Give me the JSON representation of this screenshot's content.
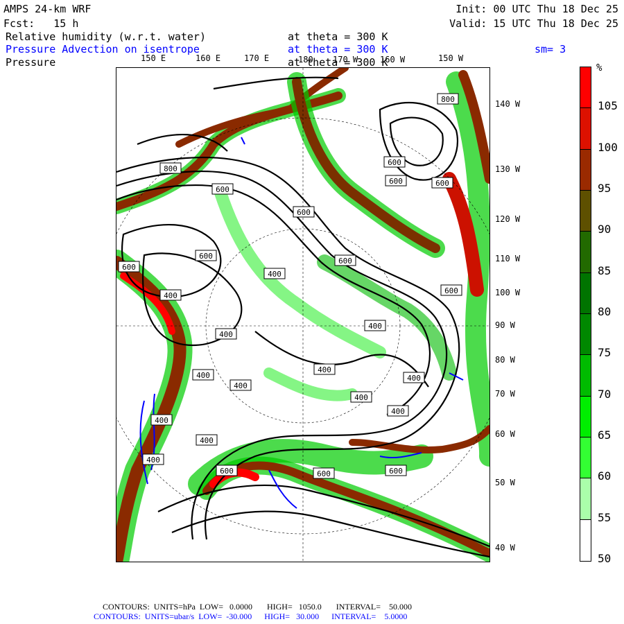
{
  "header": {
    "model": "AMPS 24-km WRF",
    "fcst": "Fcst:   15 h",
    "init": "Init: 00 UTC Thu 18 Dec 25",
    "valid": "Valid: 15 UTC Thu 18 Dec 25",
    "field1": "Relative humidity (w.r.t. water)",
    "field1_level": "at theta = 300 K",
    "field2": "Pressure Advection on isentrope",
    "field2_level": "at theta = 300 K",
    "smoothing": "sm= 3",
    "field3": "Pressure",
    "field3_level": "at theta = 300 K"
  },
  "top_longitudes": [
    "150 E",
    "160 E",
    "170 E",
    "180",
    "170 W",
    "160 W",
    "150 W"
  ],
  "right_longitudes": [
    "140 W",
    "130 W",
    "120 W",
    "110 W",
    "100 W",
    "90 W",
    "80 W",
    "70 W",
    "60 W",
    "50 W",
    "40 W"
  ],
  "contour_labels": [
    "800",
    "600",
    "600",
    "600",
    "800",
    "600",
    "600",
    "600",
    "600",
    "600",
    "400",
    "400",
    "400",
    "400",
    "400",
    "400",
    "400",
    "400",
    "400",
    "400",
    "400",
    "600",
    "600",
    "600",
    "600",
    "400",
    "400"
  ],
  "colorbar": {
    "unit": "%",
    "labels": [
      "105",
      "100",
      "95",
      "90",
      "85",
      "80",
      "75",
      "70",
      "65",
      "60",
      "55",
      "50"
    ],
    "colors": [
      "#ff0000",
      "#dd1100",
      "#9a2a00",
      "#5e5000",
      "#226a00",
      "#007400",
      "#008800",
      "#00bb00",
      "#00ee00",
      "#33ff33",
      "#aaffaa",
      "#ffffff",
      "#ffffff"
    ]
  },
  "footer": {
    "line1": "CONTOURS:  UNITS=hPa  LOW=   0.0000       HIGH=   1050.0       INTERVAL=    50.000",
    "line2": "CONTOURS:  UNITS=ubar/s  LOW=  -30.000      HIGH=   30.000      INTERVAL=    5.0000"
  }
}
